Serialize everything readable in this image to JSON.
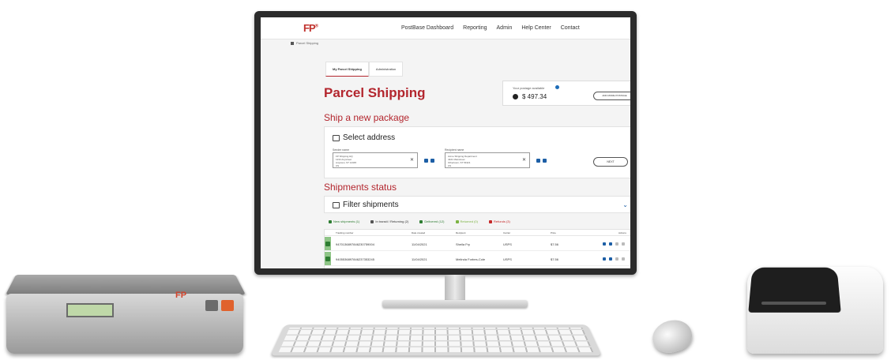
{
  "header": {
    "logo": "FP",
    "nav": [
      "PostBase Dashboard",
      "Reporting",
      "Admin",
      "Help Center",
      "Contact"
    ]
  },
  "breadcrumb": "Parcel Shipping",
  "tabs": [
    "My Parcel Shipping",
    "Administration"
  ],
  "page_title": "Parcel Shipping",
  "postage": {
    "label": "Your postage available",
    "balance": "$ 497.34",
    "add_button": "ADD MORE POSTAGE"
  },
  "ship_section": {
    "title": "Ship a new package",
    "card_title": "Select address",
    "sender_label": "Sender name",
    "sender_lines": [
      "FP Shipping HQ",
      "1234 Anystreet",
      "Anytown, ST 12345",
      "US"
    ],
    "recipient_label": "Recipient name",
    "recipient_lines": [
      "Acme Shipping Department",
      "4321 Mainstreet",
      "Othertown, ST 54321",
      "US"
    ],
    "next_button": "NEXT"
  },
  "shipments": {
    "title": "Shipments status",
    "filter_title": "Filter shipments",
    "statuses": [
      {
        "label": "New shipments (1)",
        "color": "#2e7d32"
      },
      {
        "label": "In transit / Returning (2)",
        "color": "#555555"
      },
      {
        "label": "Delivered (12)",
        "color": "#2e7d32"
      },
      {
        "label": "Returned (0)",
        "color": "#7cb342"
      },
      {
        "label": "Refunds (3)",
        "color": "#c62828"
      }
    ],
    "columns": [
      "Tracking number",
      "Date created",
      "Recipient",
      "Carrier",
      "Price",
      "Actions"
    ],
    "rows": [
      {
        "tracking": "9470136897846230759004",
        "date": "11/04/2021",
        "recipient": "Sheila Fry",
        "carrier": "USPS",
        "price": "$7.56"
      },
      {
        "tracking": "9405536897846237353245",
        "date": "11/04/2021",
        "recipient": "Melinda Forbes-Cole",
        "carrier": "USPS",
        "price": "$7.56"
      }
    ]
  },
  "hardware": {
    "scale_brand": "FP"
  },
  "colors": {
    "brand_red": "#b3262e",
    "link_blue": "#1d5fa6",
    "status_green": "#2e7d32"
  }
}
